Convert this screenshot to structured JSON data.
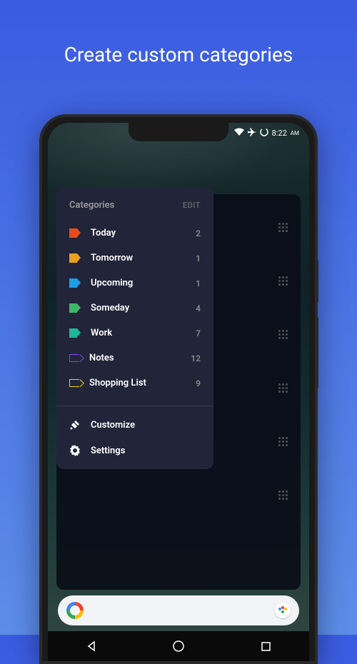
{
  "title": "Create custom categories",
  "status": {
    "time": "8:22",
    "ampm": "AM"
  },
  "sidebar": {
    "header": "Categories",
    "edit": "EDIT",
    "categories": [
      {
        "label": "Today",
        "count": "2",
        "color": "#e84b1d",
        "style": "filled"
      },
      {
        "label": "Tomorrow",
        "count": "1",
        "color": "#e8a01d",
        "style": "filled"
      },
      {
        "label": "Upcoming",
        "count": "1",
        "color": "#1d9ee8",
        "style": "filled"
      },
      {
        "label": "Someday",
        "count": "4",
        "color": "#3eb868",
        "style": "filled"
      },
      {
        "label": "Work",
        "count": "7",
        "color": "#1db89c",
        "style": "filled"
      },
      {
        "label": "Notes",
        "count": "12",
        "color": "#7b4ce8",
        "style": "outline"
      },
      {
        "label": "Shopping List",
        "count": "9",
        "color": "#e8d01d",
        "style": "outline"
      }
    ],
    "actions": {
      "customize": "Customize",
      "settings": "Settings"
    }
  }
}
